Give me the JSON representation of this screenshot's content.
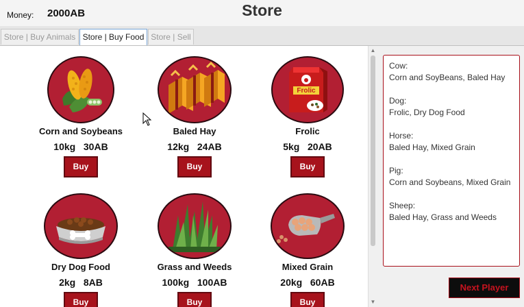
{
  "header": {
    "money_label": "Money:",
    "money_value": "2000AB",
    "title": "Store"
  },
  "tabs": [
    {
      "label": "Store | Buy Animals",
      "active": false
    },
    {
      "label": "Store | Buy Food",
      "active": true
    },
    {
      "label": "Store | Sell",
      "active": false
    }
  ],
  "items": [
    {
      "name": "Corn and Soybeans",
      "weight": "10kg",
      "price": "30AB",
      "buy_label": "Buy",
      "icon": "corn-icon"
    },
    {
      "name": "Baled Hay",
      "weight": "12kg",
      "price": "24AB",
      "buy_label": "Buy",
      "icon": "hay-bale-icon"
    },
    {
      "name": "Frolic",
      "weight": "5kg",
      "price": "20AB",
      "buy_label": "Buy",
      "icon": "dog-food-bag-icon",
      "package_text": "Frolic"
    },
    {
      "name": "Dry Dog Food",
      "weight": "2kg",
      "price": "8AB",
      "buy_label": "Buy",
      "icon": "dog-bowl-icon"
    },
    {
      "name": "Grass and Weeds",
      "weight": "100kg",
      "price": "100AB",
      "buy_label": "Buy",
      "icon": "grass-icon"
    },
    {
      "name": "Mixed Grain",
      "weight": "20kg",
      "price": "60AB",
      "buy_label": "Buy",
      "icon": "grain-scoop-icon"
    }
  ],
  "info": [
    {
      "animal": "Cow:",
      "foods": "Corn and SoyBeans, Baled Hay"
    },
    {
      "animal": "Dog:",
      "foods": "Frolic, Dry Dog Food"
    },
    {
      "animal": "Horse:",
      "foods": "Baled Hay, Mixed Grain"
    },
    {
      "animal": "Pig:",
      "foods": "Corn and Soybeans, Mixed Grain"
    },
    {
      "animal": "Sheep:",
      "foods": "Baled Hay, Grass and Weeds"
    }
  ],
  "next_button": "Next Player",
  "colors": {
    "accent": "#a7131c",
    "circle": "#b21f33",
    "button_dark": "#0d0d0d"
  }
}
